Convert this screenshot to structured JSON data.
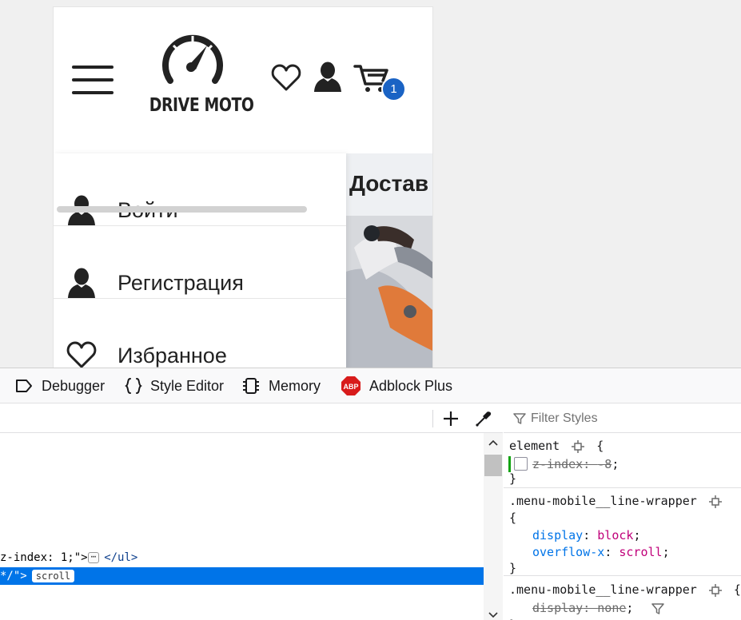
{
  "site": {
    "logo_text": "DRIVE MOTO",
    "cart_count": "1",
    "content_title": "Достав",
    "menu": [
      {
        "label": "Войти",
        "icon": "user-icon"
      },
      {
        "label": "Регистрация",
        "icon": "user-icon"
      },
      {
        "label": "Избранное",
        "icon": "heart-icon"
      }
    ]
  },
  "devtools": {
    "tabs": [
      {
        "label": "Debugger",
        "icon": "debugger-icon"
      },
      {
        "label": "Style Editor",
        "icon": "braces-icon"
      },
      {
        "label": "Memory",
        "icon": "memory-chip-icon"
      },
      {
        "label": "Adblock Plus",
        "icon": "abp-icon"
      }
    ],
    "abp_badge": "ABP",
    "markup": {
      "line1_text": "z-index: 1;\">",
      "line1_ellipsis": "⋯",
      "line1_close": "</ul>",
      "line2_text": "*/\">",
      "line2_badge": "scroll"
    },
    "filter_placeholder": "Filter Styles",
    "rules": {
      "r1_selector": "element",
      "r1_prop": "z-index",
      "r1_value": "-8",
      "r2_selector": ".menu-mobile__line-wrapper",
      "r2_prop1": "display",
      "r2_val1": "block",
      "r2_prop2": "overflow-x",
      "r2_val2": "scroll",
      "r3_selector": ".menu-mobile__line-wrapper",
      "r3_prop": "display",
      "r3_value": "none",
      "open_brace": "{",
      "close_brace": "}"
    }
  },
  "colors": {
    "accent": "#1a63c4",
    "selection": "#0074e8",
    "prop": "#0074e8",
    "value": "#c0007a"
  }
}
